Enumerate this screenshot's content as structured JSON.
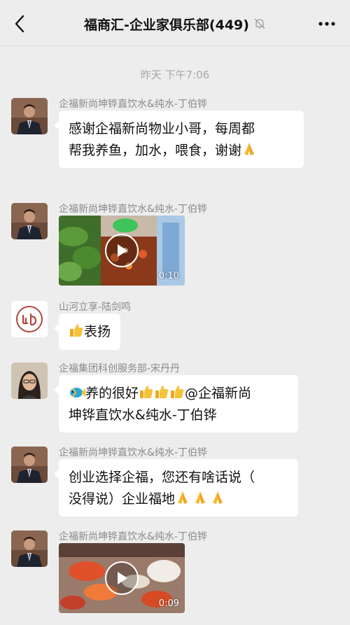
{
  "header": {
    "title": "福商汇-企业家俱乐部(449)",
    "back_icon": "chevron-left-icon",
    "mute_icon": "bell-slash-icon",
    "more_icon": "more-dots-icon"
  },
  "chat": {
    "timestamp": "昨天 下午7:06",
    "messages": [
      {
        "sender": "企福新尚坤铧直饮水&纯水-丁伯铧",
        "type": "text",
        "lines": [
          "感谢企福新尚物业小哥，每周都",
          "帮我养鱼，加水，喂食，谢谢"
        ],
        "trailing_emoji": "folded-hands"
      },
      {
        "sender": "企福新尚坤铧直饮水&纯水-丁伯铧",
        "type": "video",
        "duration": "0:10"
      },
      {
        "sender": "山河立享-陆剑鸣",
        "type": "text",
        "lines": [
          "表扬"
        ],
        "leading_emoji": "thumbs-up"
      },
      {
        "sender": "企福集团科创服务部-宋丹丹",
        "type": "text",
        "lines": [
          "养的很好",
          "@企福新尚",
          "坤铧直饮水&纯水-丁伯铧"
        ],
        "leading_emoji": "tropical-fish"
      },
      {
        "sender": "企福新尚坤铧直饮水&纯水-丁伯铧",
        "type": "text",
        "lines": [
          "创业选择企福，您还有啥话说（",
          "没得说）企业福地"
        ]
      },
      {
        "sender": "企福新尚坤铧直饮水&纯水-丁伯铧",
        "type": "video",
        "duration": "0:09"
      }
    ]
  },
  "colors": {
    "background": "#ededed",
    "bubble": "#ffffff",
    "sender_text": "#8a8a8a",
    "timestamp_text": "#a8a8a8"
  }
}
